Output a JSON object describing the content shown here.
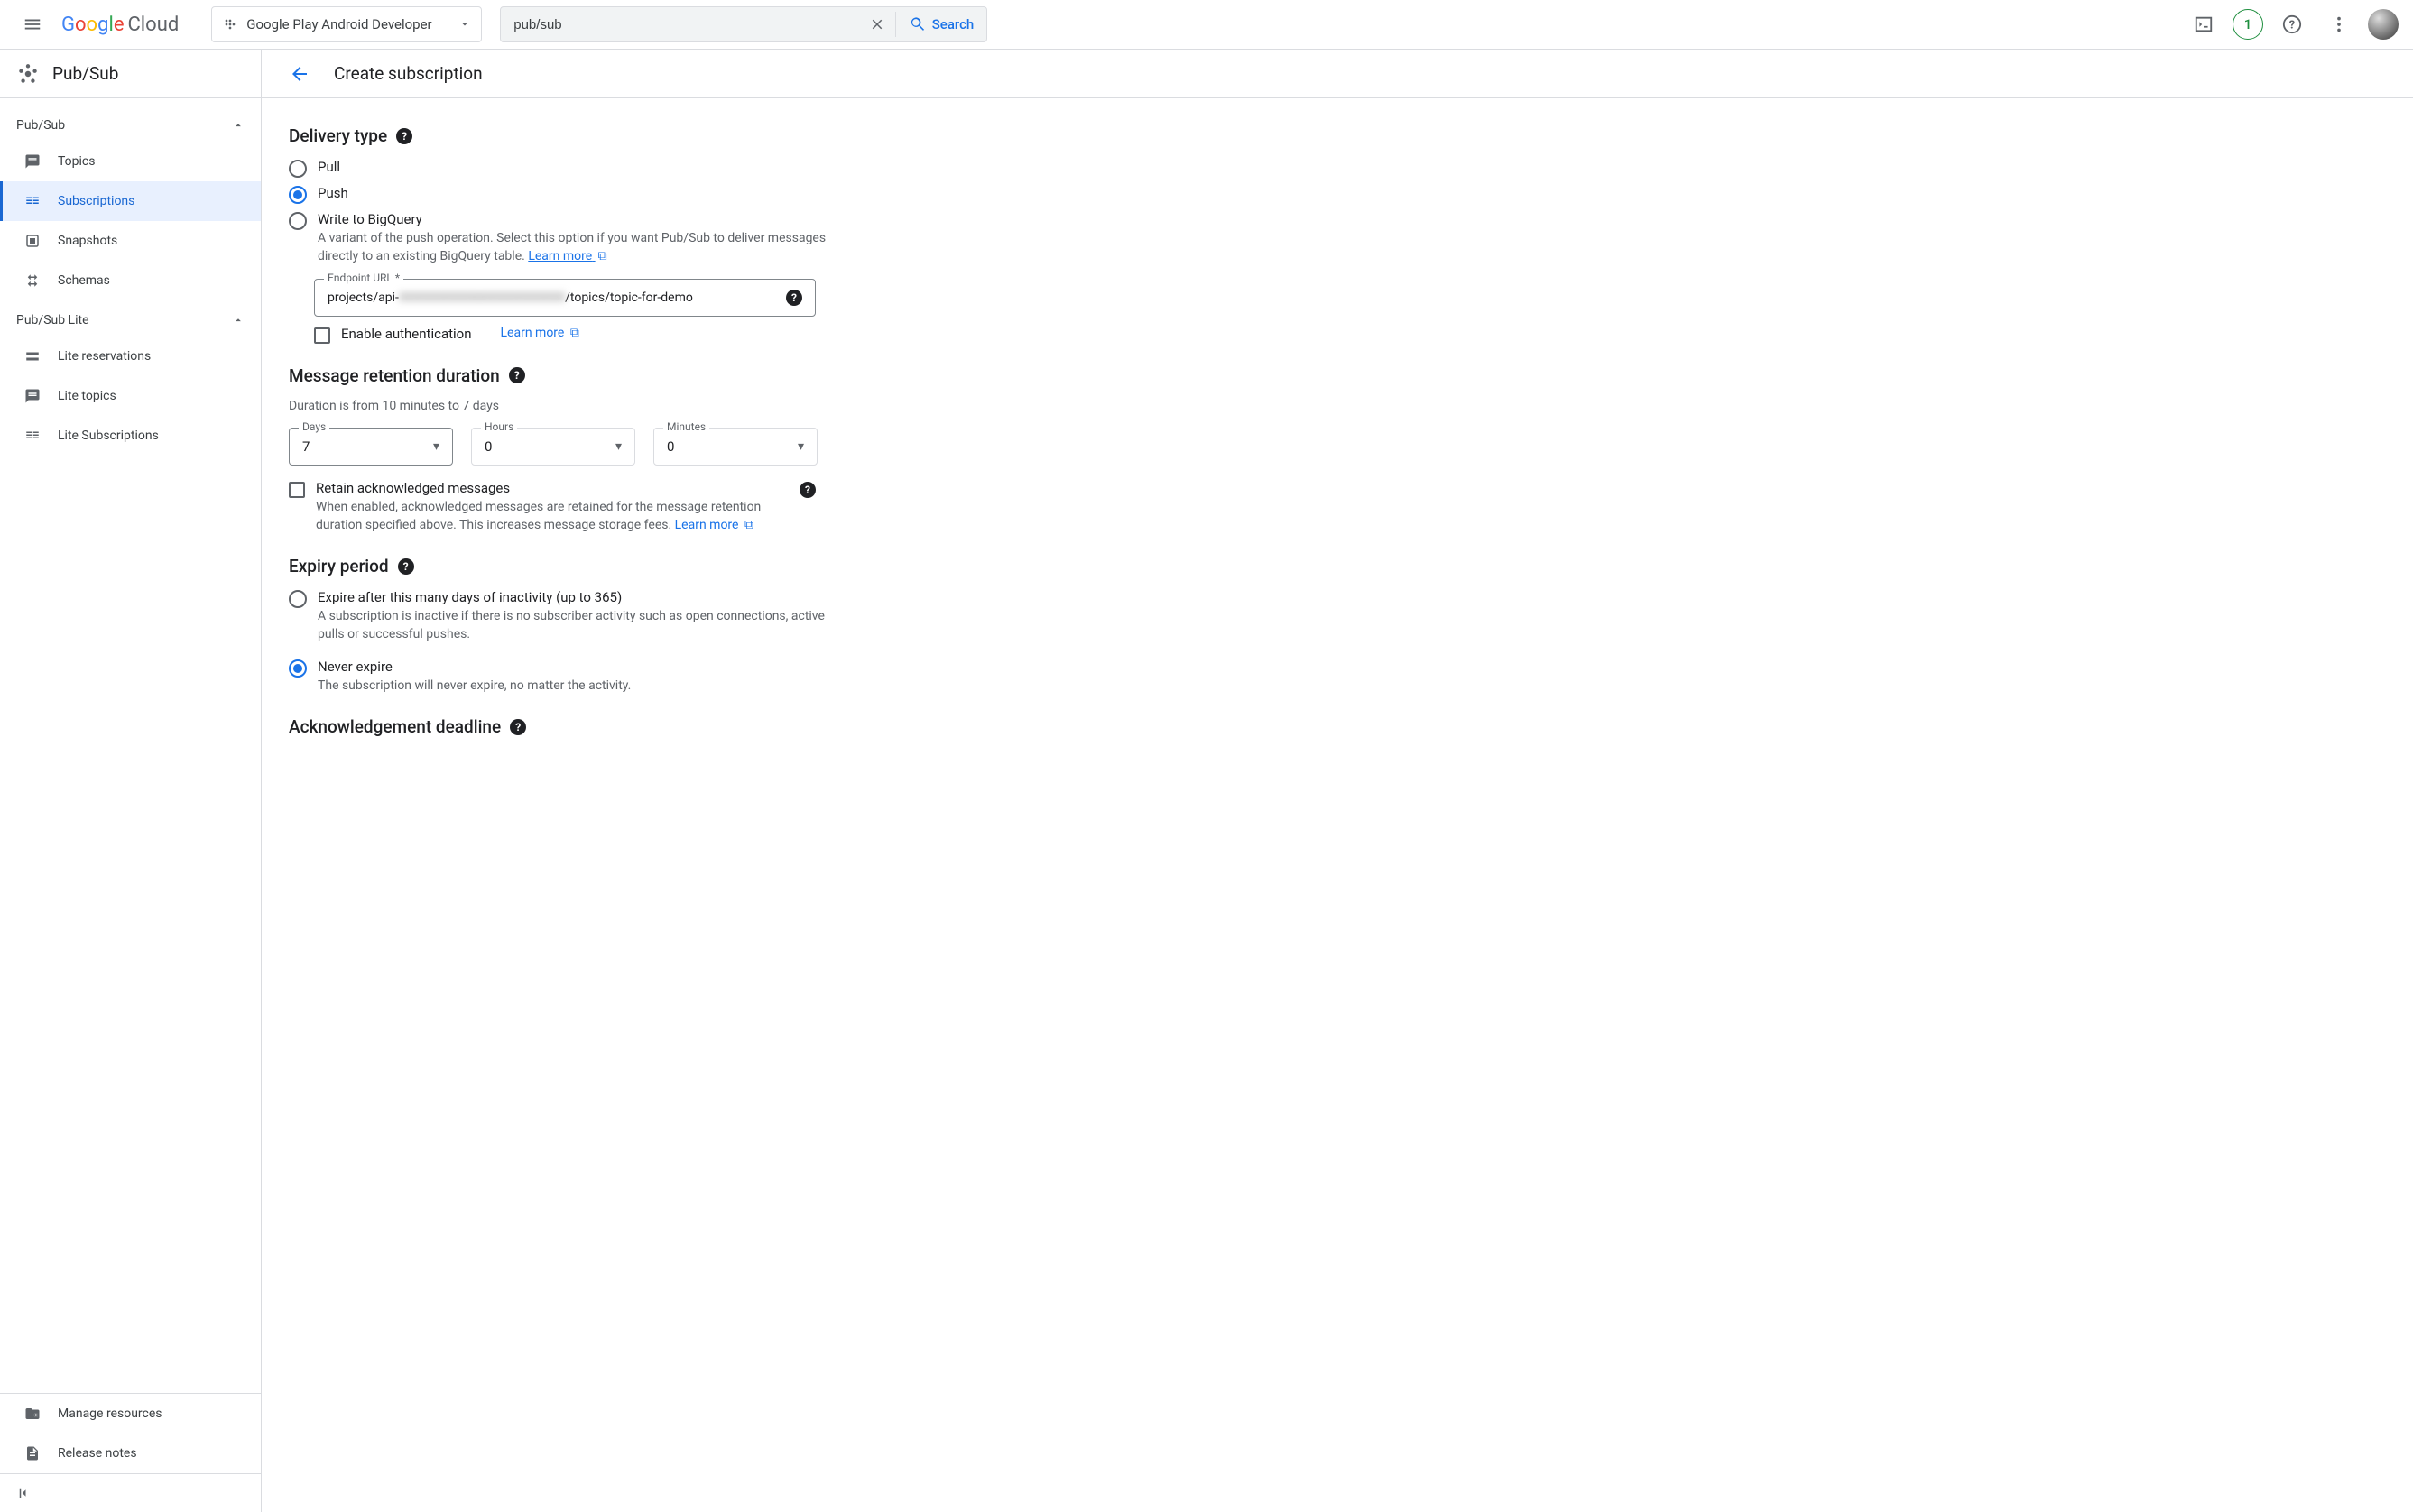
{
  "topbar": {
    "logo_text": "Google",
    "logo_suffix": "Cloud",
    "project_name": "Google Play Android Developer",
    "search_value": "pub/sub",
    "search_button": "Search",
    "trial_count": "1"
  },
  "sidebar": {
    "product_title": "Pub/Sub",
    "groups": [
      {
        "title": "Pub/Sub",
        "items": [
          {
            "label": "Topics",
            "active": false
          },
          {
            "label": "Subscriptions",
            "active": true
          },
          {
            "label": "Snapshots",
            "active": false
          },
          {
            "label": "Schemas",
            "active": false
          }
        ]
      },
      {
        "title": "Pub/Sub Lite",
        "items": [
          {
            "label": "Lite reservations",
            "active": false
          },
          {
            "label": "Lite topics",
            "active": false
          },
          {
            "label": "Lite Subscriptions",
            "active": false
          }
        ]
      }
    ],
    "footer": [
      {
        "label": "Manage resources"
      },
      {
        "label": "Release notes"
      }
    ]
  },
  "page": {
    "title": "Create subscription"
  },
  "form": {
    "delivery_type": {
      "heading": "Delivery type",
      "options": {
        "pull": "Pull",
        "push": "Push",
        "bigquery": "Write to BigQuery",
        "bigquery_desc": "A variant of the push operation. Select this option if you want Pub/Sub to deliver messages directly to an existing BigQuery table.",
        "learn_more": "Learn more"
      },
      "endpoint": {
        "label": "Endpoint URL *",
        "value_prefix": "projects/api-",
        "value_blurred": "0000000000000000000000000",
        "value_suffix": "/topics/topic-for-demo"
      },
      "enable_auth": "Enable authentication",
      "enable_auth_learn": "Learn more"
    },
    "retention": {
      "heading": "Message retention duration",
      "hint": "Duration is from 10 minutes to 7 days",
      "days_label": "Days",
      "days_value": "7",
      "hours_label": "Hours",
      "hours_value": "0",
      "minutes_label": "Minutes",
      "minutes_value": "0",
      "retain_label": "Retain acknowledged messages",
      "retain_desc": "When enabled, acknowledged messages are retained for the message retention duration specified above. This increases message storage fees. ",
      "retain_learn": "Learn more"
    },
    "expiry": {
      "heading": "Expiry period",
      "option_days": "Expire after this many days of inactivity (up to 365)",
      "option_days_desc": "A subscription is inactive if there is no subscriber activity such as open connections, active pulls or successful pushes.",
      "option_never": "Never expire",
      "option_never_desc": "The subscription will never expire, no matter the activity."
    },
    "ack": {
      "heading": "Acknowledgement deadline"
    }
  }
}
